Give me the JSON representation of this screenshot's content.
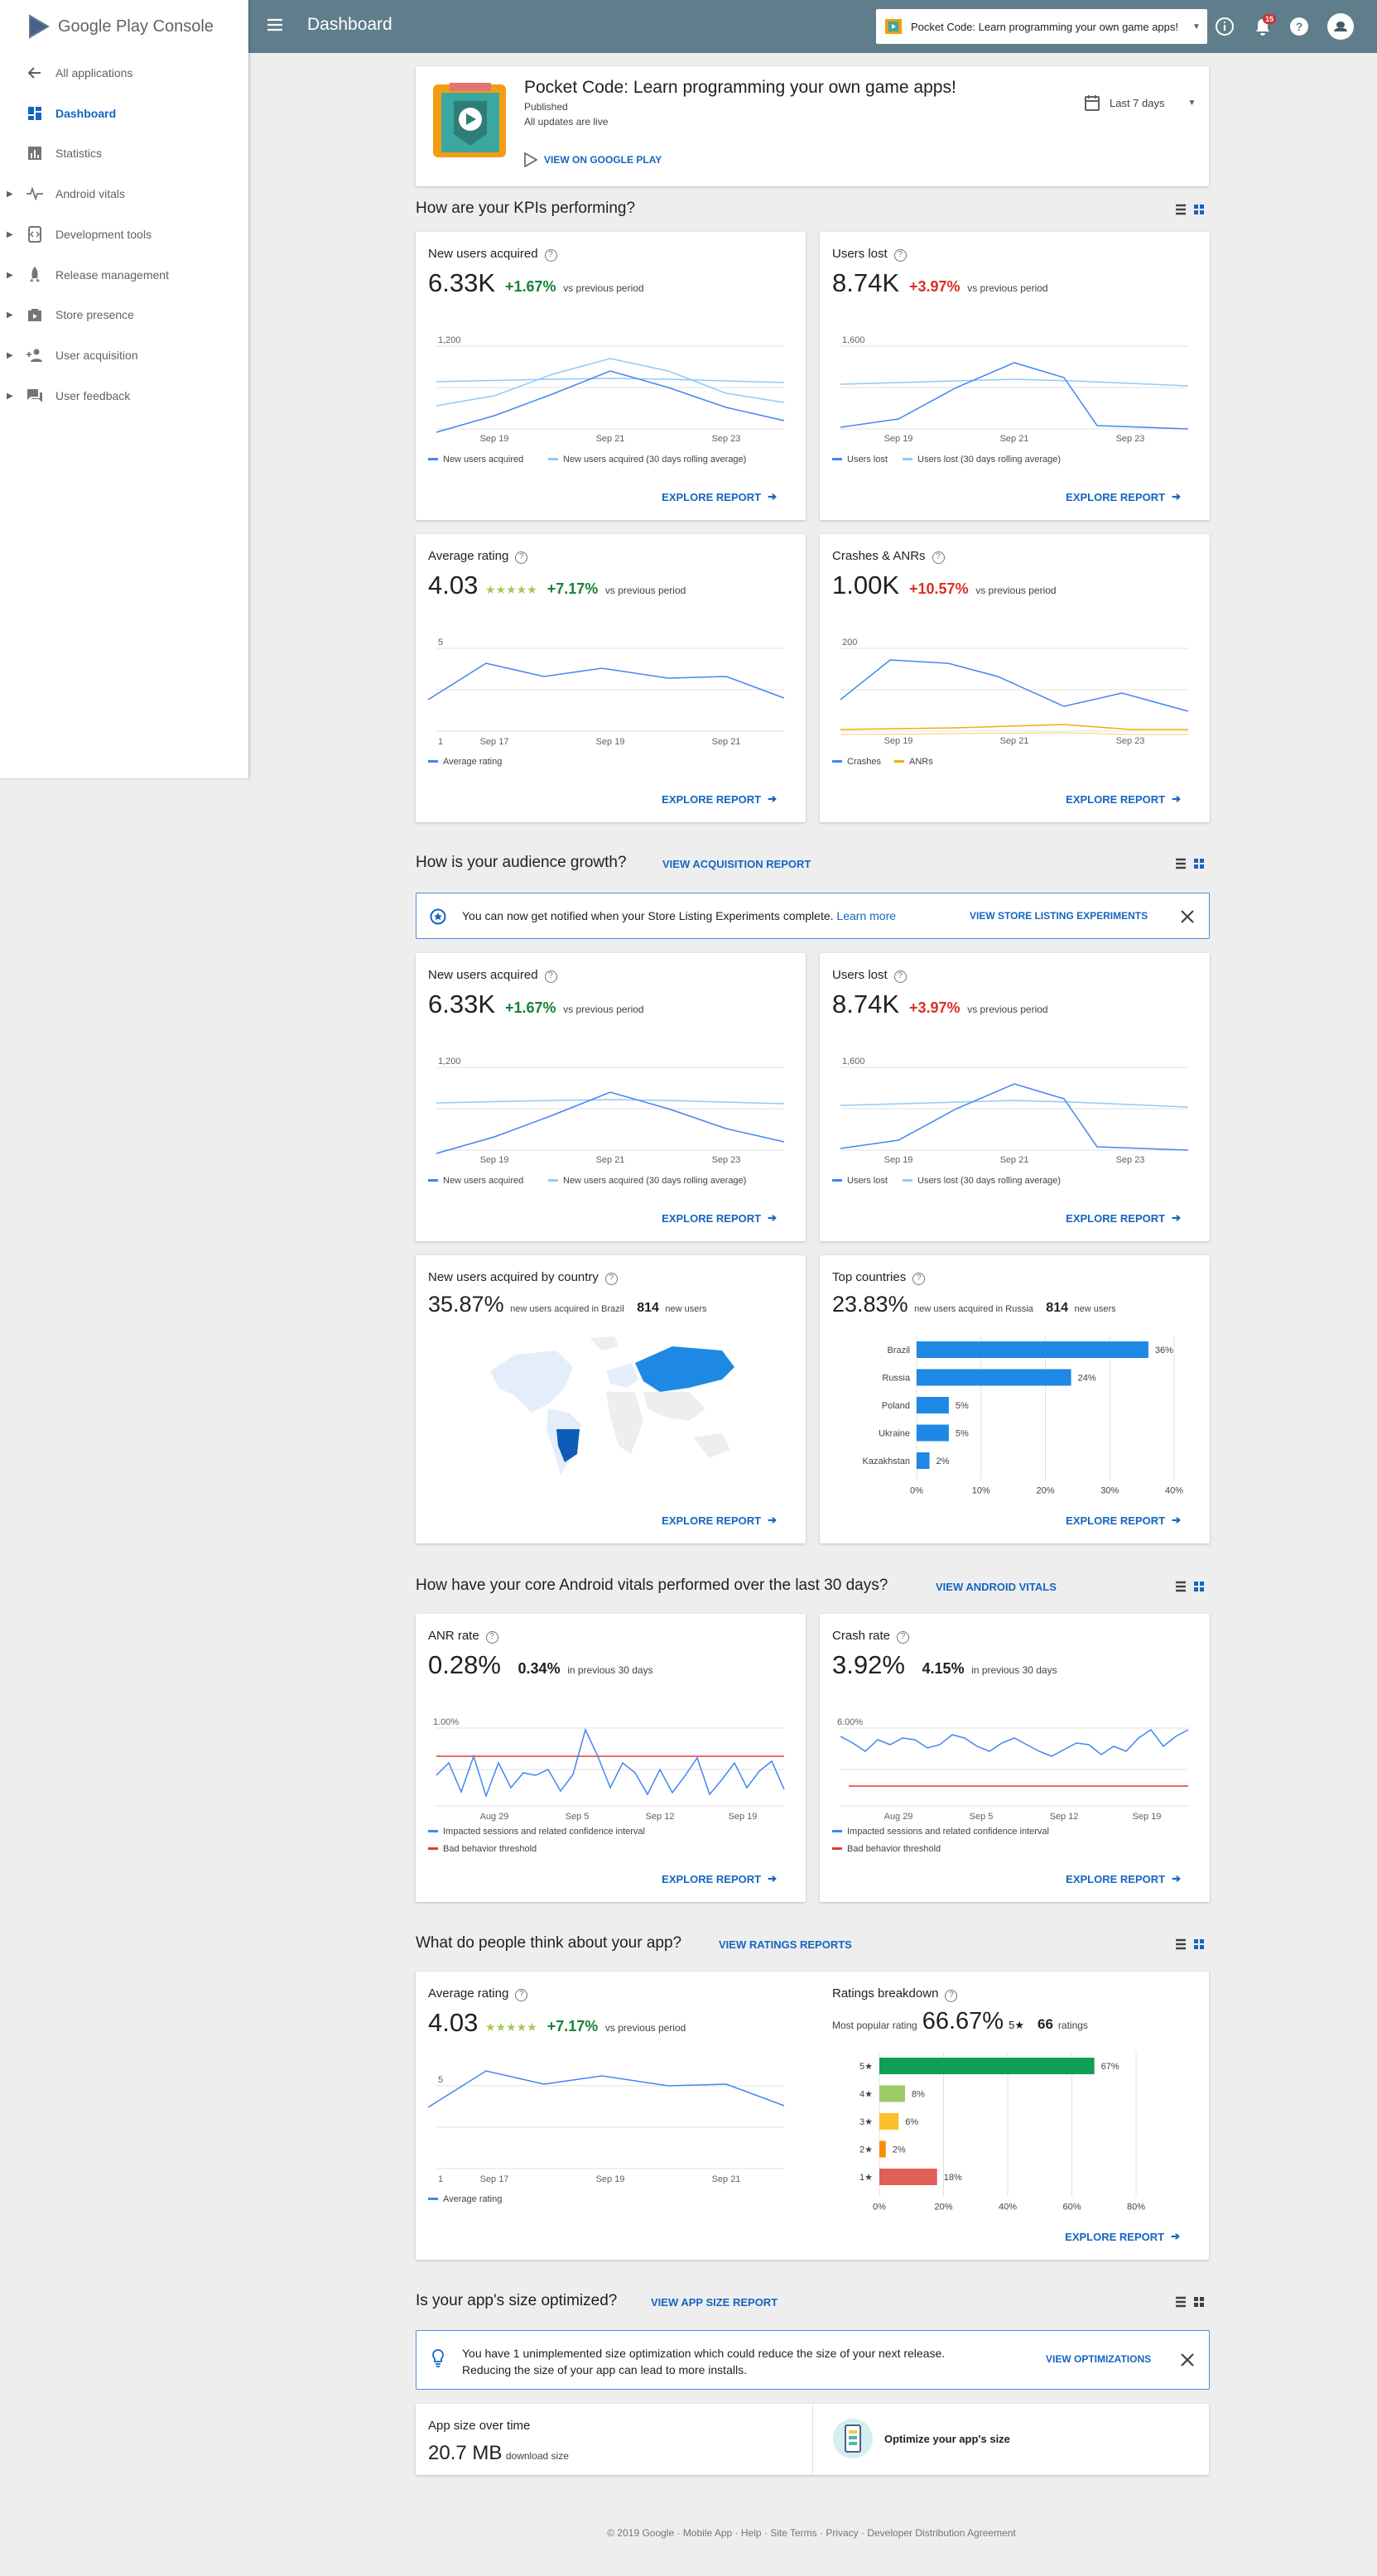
{
  "brand": {
    "name": "Google Play",
    "suffix": "Console"
  },
  "sidebar": {
    "items": [
      {
        "label": "All applications",
        "icon": "arrow-back-icon"
      },
      {
        "label": "Dashboard",
        "icon": "dashboard-icon"
      },
      {
        "label": "Statistics",
        "icon": "bar-chart-icon"
      },
      {
        "label": "Android vitals",
        "icon": "pulse-icon"
      },
      {
        "label": "Development tools",
        "icon": "code-icon"
      },
      {
        "label": "Release management",
        "icon": "rocket-icon"
      },
      {
        "label": "Store presence",
        "icon": "store-icon"
      },
      {
        "label": "User acquisition",
        "icon": "person-add-icon"
      },
      {
        "label": "User feedback",
        "icon": "feedback-icon"
      }
    ]
  },
  "topbar": {
    "title": "Dashboard",
    "app_selector": "Pocket Code: Learn programming your own game apps!",
    "notification_count": "15"
  },
  "app_header": {
    "name": "Pocket Code: Learn programming your own game apps!",
    "status": "Published",
    "updates": "All updates are live",
    "play_link": "VIEW ON GOOGLE PLAY",
    "date_range": "Last 7 days"
  },
  "kpi_section": {
    "title": "How are your KPIs performing?"
  },
  "cards": {
    "new_users": {
      "title": "New users acquired",
      "value": "6.33K",
      "delta": "+1.67%",
      "compare": "vs previous period",
      "y_label": "1,200",
      "x_ticks": [
        "Sep 19",
        "Sep 21",
        "Sep 23"
      ],
      "legend": [
        "New users acquired",
        "New users acquired (30 days rolling average)"
      ],
      "explore": "EXPLORE REPORT"
    },
    "users_lost": {
      "title": "Users lost",
      "value": "8.74K",
      "delta": "+3.97%",
      "compare": "vs previous period",
      "y_label": "1,600",
      "x_ticks": [
        "Sep 19",
        "Sep 21",
        "Sep 23"
      ],
      "legend": [
        "Users lost",
        "Users lost (30 days rolling average)"
      ],
      "explore": "EXPLORE REPORT"
    },
    "avg_rating": {
      "title": "Average rating",
      "value": "4.03",
      "stars": "★★★★★",
      "delta": "+7.17%",
      "compare": "vs previous period",
      "y_top": "5",
      "y_bottom": "1",
      "x_ticks": [
        "Sep 17",
        "Sep 19",
        "Sep 21"
      ],
      "legend": [
        "Average rating"
      ],
      "explore": "EXPLORE REPORT"
    },
    "crashes": {
      "title": "Crashes & ANRs",
      "value": "1.00K",
      "delta": "+10.57%",
      "compare": "vs previous period",
      "y_label": "200",
      "x_ticks": [
        "Sep 19",
        "Sep 21",
        "Sep 23"
      ],
      "legend": [
        "Crashes",
        "ANRs"
      ],
      "explore": "EXPLORE REPORT"
    }
  },
  "audience": {
    "title": "How is your audience growth?",
    "link": "VIEW ACQUISITION REPORT",
    "notice": {
      "text": "You can now get notified when your Store Listing Experiments complete.",
      "learn_more": "Learn more",
      "action": "VIEW STORE LISTING EXPERIMENTS"
    },
    "by_country": {
      "title": "New users acquired by country",
      "value": "35.87%",
      "desc": "new users acquired in Brazil",
      "count": "814",
      "count_label": "new users",
      "explore": "EXPLORE REPORT"
    },
    "top_countries": {
      "title": "Top countries",
      "value": "23.83%",
      "desc": "new users acquired in Russia",
      "count": "814",
      "count_label": "new users",
      "explore": "EXPLORE REPORT"
    }
  },
  "vitals": {
    "title": "How have your core Android vitals performed over the last 30 days?",
    "link": "VIEW ANDROID VITALS",
    "anr": {
      "title": "ANR rate",
      "value": "0.28%",
      "prev": "0.34%",
      "prev_label": "in previous 30 days",
      "y_label": "1.00%",
      "x_ticks": [
        "Aug 29",
        "Sep 5",
        "Sep 12",
        "Sep 19"
      ],
      "legend": [
        "Impacted sessions and related confidence interval",
        "Bad behavior threshold"
      ],
      "explore": "EXPLORE REPORT"
    },
    "crash": {
      "title": "Crash rate",
      "value": "3.92%",
      "prev": "4.15%",
      "prev_label": "in previous 30 days",
      "y_label": "6.00%",
      "x_ticks": [
        "Aug 29",
        "Sep 5",
        "Sep 12",
        "Sep 19"
      ],
      "legend": [
        "Impacted sessions and related confidence interval",
        "Bad behavior threshold"
      ],
      "explore": "EXPLORE REPORT"
    }
  },
  "ratings": {
    "title": "What do people think about your app?",
    "link": "VIEW RATINGS REPORTS",
    "avg": {
      "title": "Average rating",
      "value": "4.03",
      "stars": "★★★★★",
      "delta": "+7.17%",
      "compare": "vs previous period",
      "y_top": "5",
      "y_bottom": "1",
      "x_ticks": [
        "Sep 17",
        "Sep 19",
        "Sep 21"
      ],
      "legend": [
        "Average rating"
      ]
    },
    "breakdown": {
      "title": "Ratings breakdown",
      "popular_label": "Most popular rating",
      "popular_value": "66.67%",
      "popular_star": "5★",
      "count": "66",
      "count_label": "ratings",
      "explore": "EXPLORE REPORT"
    }
  },
  "size": {
    "title": "Is your app's size optimized?",
    "link": "VIEW APP SIZE REPORT",
    "notice": {
      "line1": "You have 1 unimplemented size optimization which could reduce the size of your next release.",
      "line2": "Reducing the size of your app can lead to more installs.",
      "action": "VIEW OPTIMIZATIONS"
    },
    "over_time": {
      "title": "App size over time",
      "value": "20.7 MB",
      "label": "download size"
    },
    "optimize": {
      "label": "Optimize your app's size"
    }
  },
  "footer": {
    "text": "© 2019 Google · Mobile App · Help · Site Terms · Privacy · Developer Distribution Agreement"
  },
  "colors": {
    "topbar": "#607d8b",
    "accent": "#1565c0",
    "line": "#4285f4",
    "line_avg": "#90caf9",
    "positive": "#188038",
    "negative": "#d93025",
    "threshold": "#e53935",
    "anrs": "#f9ab00"
  },
  "chart_data": [
    {
      "type": "bar",
      "title": "Top countries",
      "categories": [
        "Brazil",
        "Russia",
        "Poland",
        "Ukraine",
        "Kazakhstan"
      ],
      "values": [
        36,
        24,
        5,
        5,
        2
      ],
      "unit": "%",
      "xlim": [
        0,
        40
      ],
      "x_ticks": [
        "0%",
        "10%",
        "20%",
        "30%",
        "40%"
      ]
    },
    {
      "type": "bar",
      "title": "Ratings breakdown",
      "categories": [
        "5★",
        "4★",
        "3★",
        "2★",
        "1★"
      ],
      "values": [
        67,
        8,
        6,
        2,
        18
      ],
      "unit": "%",
      "xlim": [
        0,
        80
      ],
      "x_ticks": [
        "0%",
        "20%",
        "40%",
        "60%",
        "80%"
      ],
      "colors": [
        "#0f9d58",
        "#9ccc65",
        "#fbc02d",
        "#fb8c00",
        "#e06055"
      ]
    }
  ]
}
